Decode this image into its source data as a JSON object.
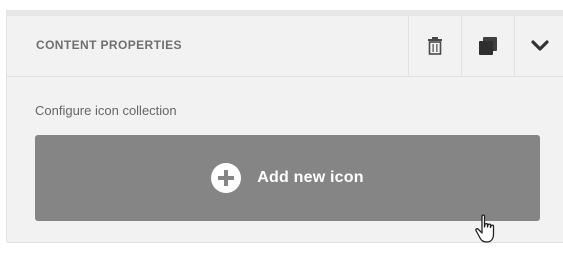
{
  "panel": {
    "title": "CONTENT PROPERTIES",
    "toolbar": {
      "delete_icon": "trash-icon",
      "duplicate_icon": "copy-icon",
      "collapse_icon": "chevron-down-icon"
    }
  },
  "content": {
    "config_label": "Configure icon collection",
    "add_button": {
      "label": "Add new icon",
      "icon": "plus-circle-icon",
      "background": "#858585"
    }
  },
  "cursor": {
    "icon": "hand-pointer-icon"
  }
}
